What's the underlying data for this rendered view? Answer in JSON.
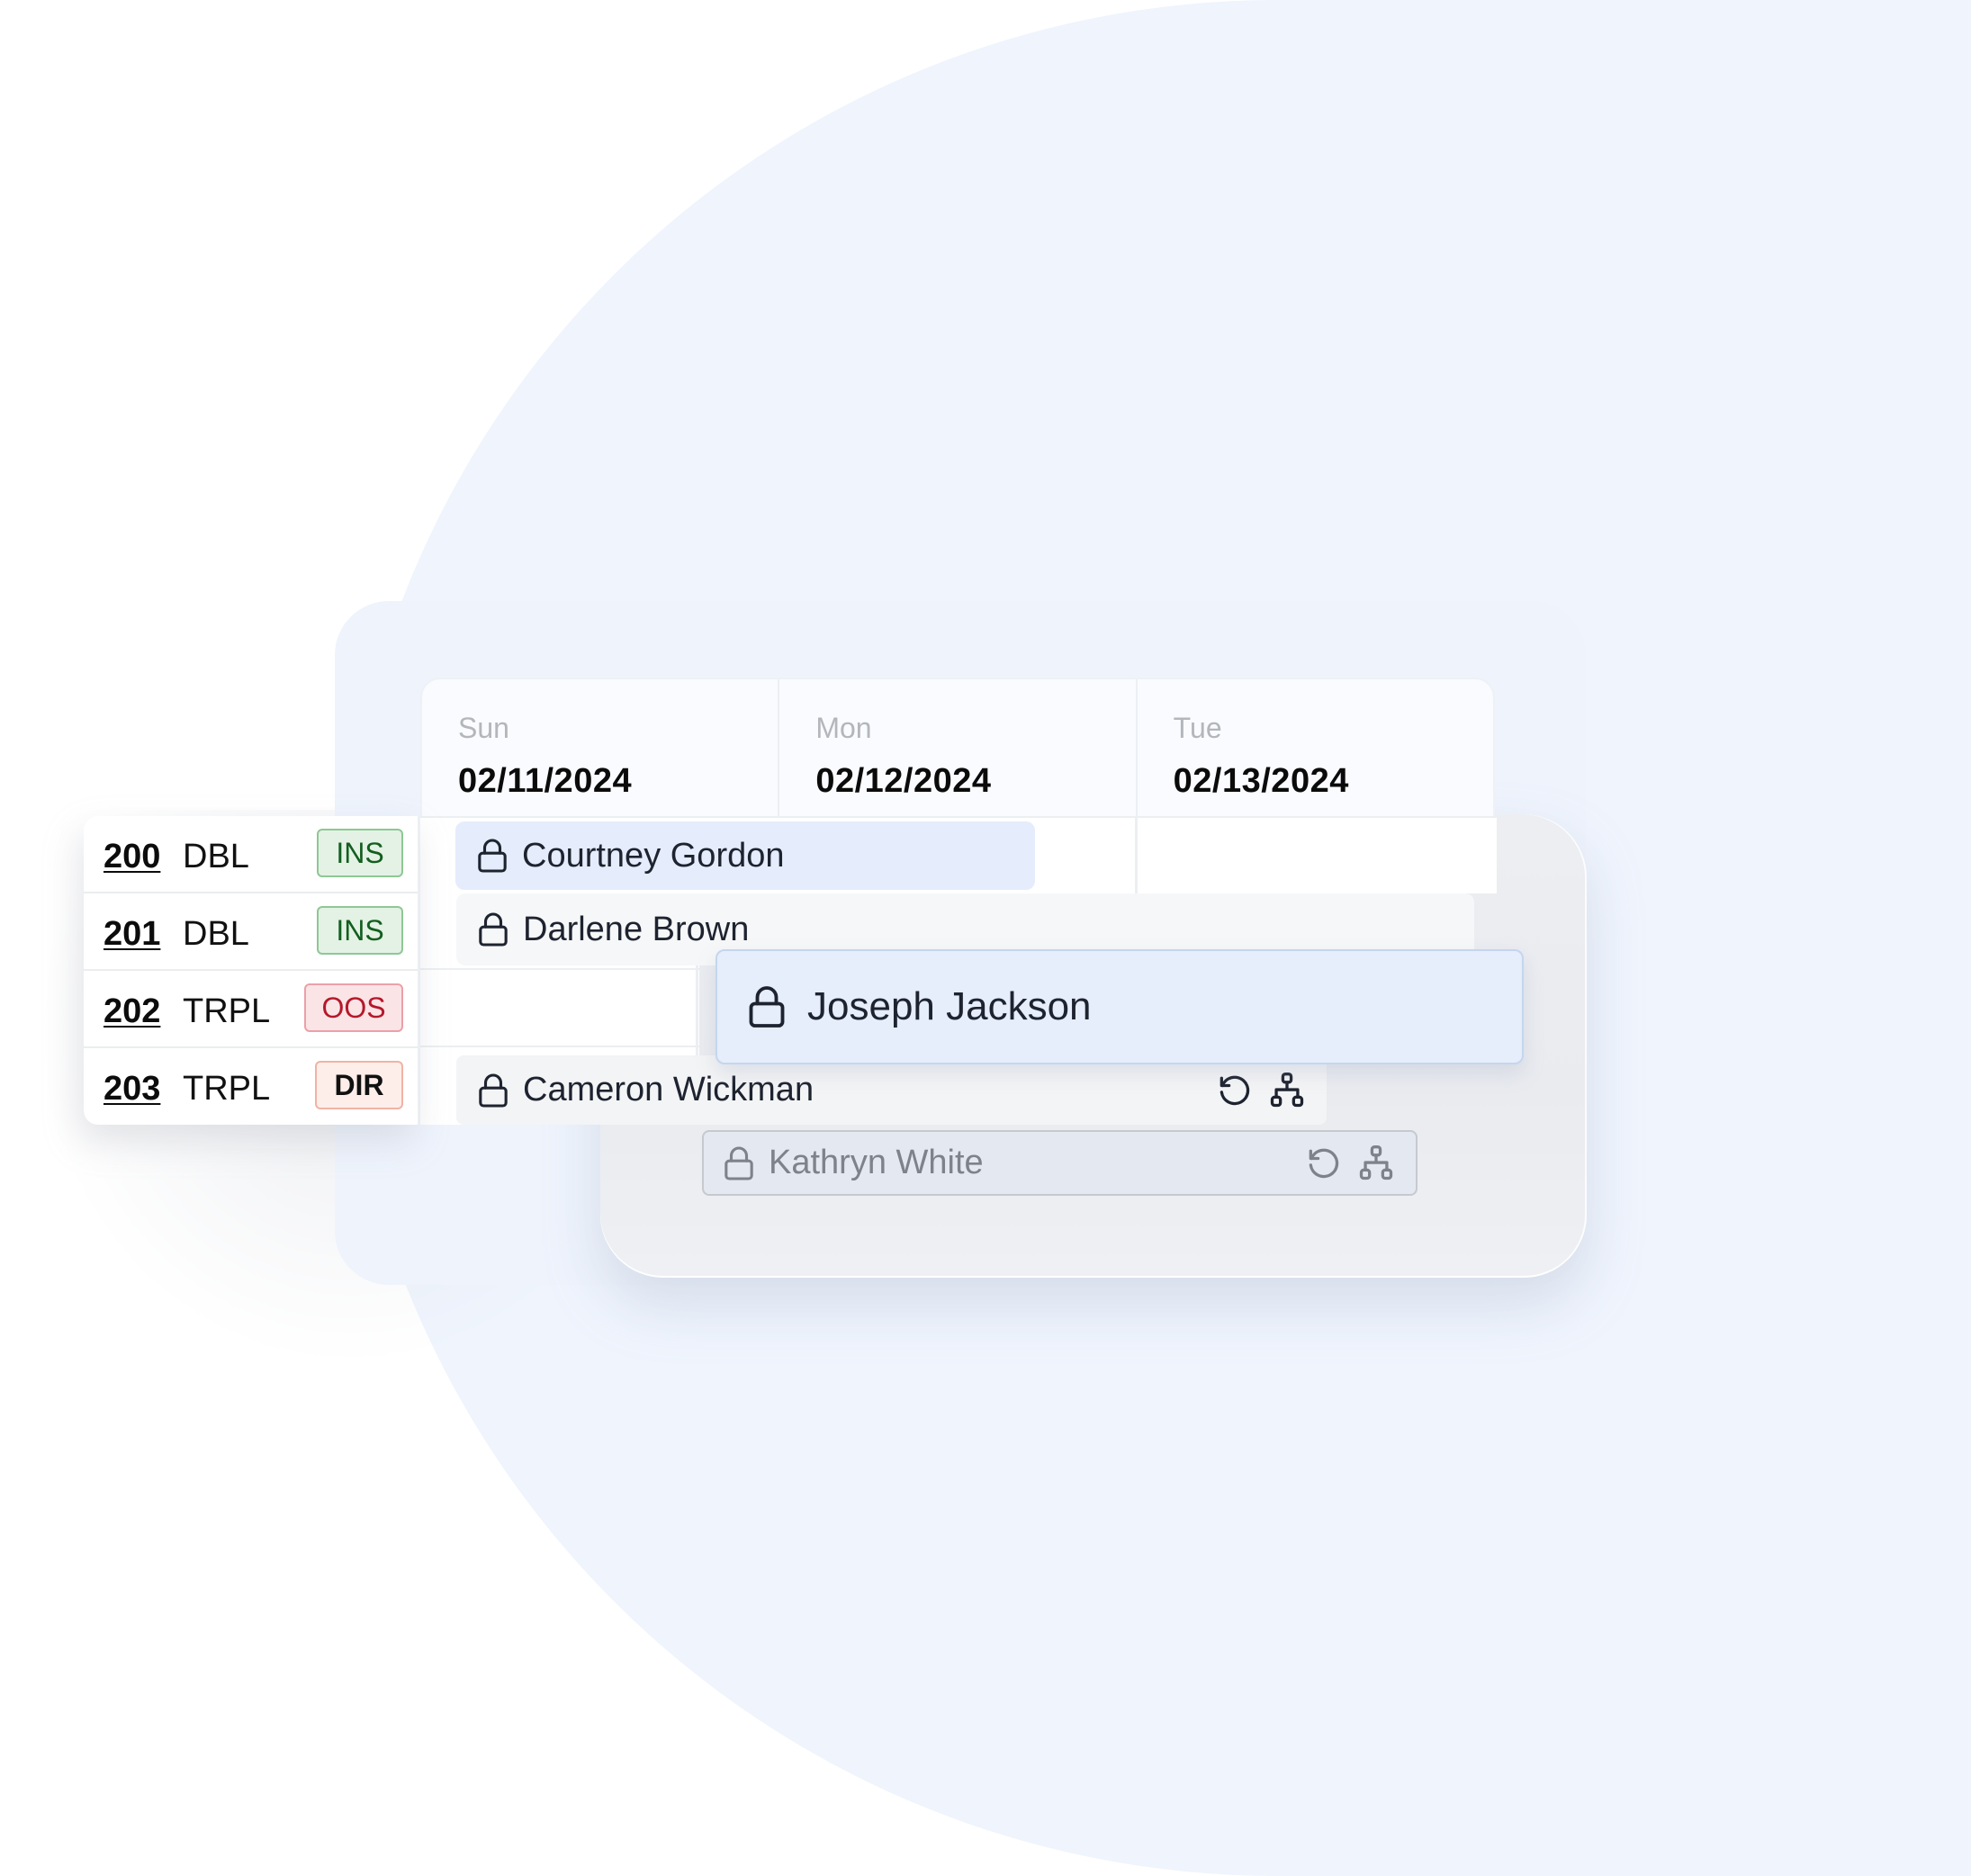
{
  "calendar": {
    "columns": [
      {
        "day": "Sun",
        "date": "02/11/2024"
      },
      {
        "day": "Mon",
        "date": "02/12/2024"
      },
      {
        "day": "Tue",
        "date": "02/13/2024"
      }
    ]
  },
  "rooms": [
    {
      "number": "200",
      "type": "DBL",
      "status": "INS",
      "status_color": "#135e1f"
    },
    {
      "number": "201",
      "type": "DBL",
      "status": "INS",
      "status_color": "#135e1f"
    },
    {
      "number": "202",
      "type": "TRPL",
      "status": "OOS",
      "status_color": "#b5182a"
    },
    {
      "number": "203",
      "type": "TRPL",
      "status": "DIR",
      "status_color": "#111111"
    }
  ],
  "reservations": [
    {
      "guest": "Courtney Gordon",
      "room": "200",
      "icon": "lock-icon",
      "state": "highlighted"
    },
    {
      "guest": "Darlene Brown",
      "room": "201",
      "icon": "lock-icon",
      "state": "normal"
    },
    {
      "guest": "Joseph Jackson",
      "room": "202",
      "icon": "lock-icon",
      "state": "dragging"
    },
    {
      "guest": "Cameron Wickman",
      "room": "203",
      "icon": "lock-icon",
      "state": "normal",
      "actions": [
        "refresh-icon",
        "hierarchy-icon"
      ]
    },
    {
      "guest": "Kathryn White",
      "room": "",
      "icon": "lock-icon",
      "state": "unassigned",
      "actions": [
        "refresh-icon",
        "hierarchy-icon"
      ]
    }
  ],
  "colors": {
    "accent_blue": "#e5ecfb",
    "background_blob": "#eff4fd",
    "ins_badge_bg": "#e3f2e4",
    "oos_badge_bg": "#fbe4e6",
    "dir_badge_bg": "#fdeeea"
  }
}
